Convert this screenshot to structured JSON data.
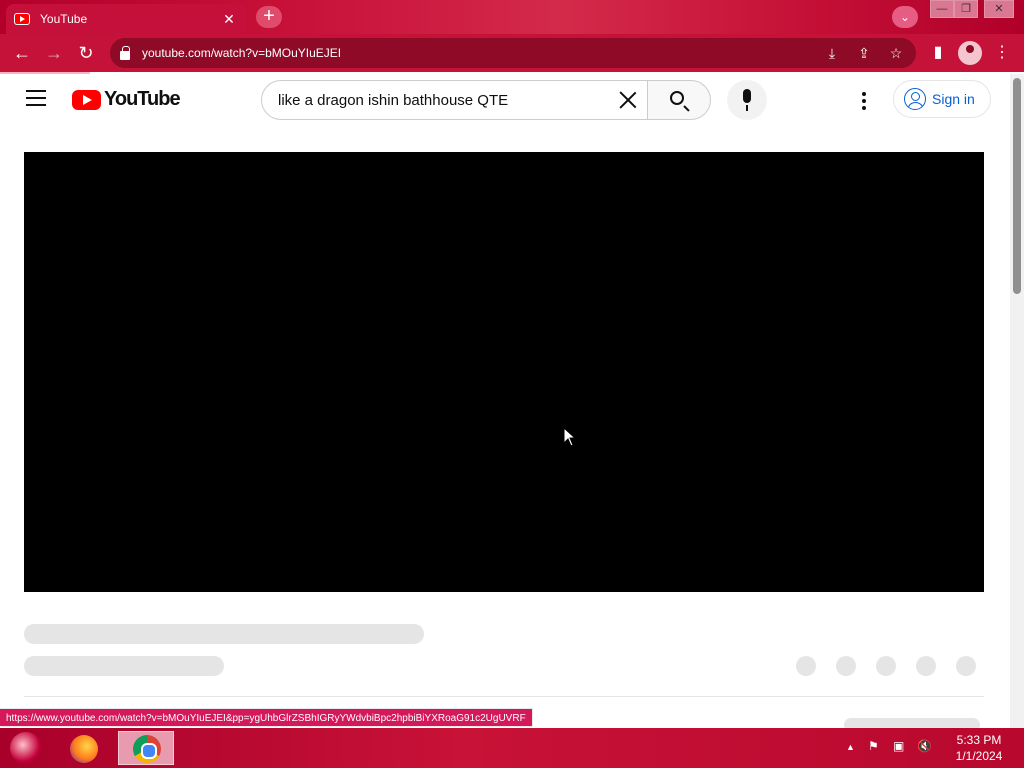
{
  "browser": {
    "tab_title": "YouTube",
    "tab_close": "✕",
    "new_tab": "+",
    "tab_search": "⌄",
    "url": "youtube.com/watch?v=bMOuYIuEJEI",
    "window_controls": [
      "—",
      "❐",
      "✕"
    ]
  },
  "youtube": {
    "logo_text": "YouTube",
    "search_query": "like a dragon ishin bathhouse QTE",
    "sign_in_label": "Sign in"
  },
  "status_url": "https://www.youtube.com/watch?v=bMOuYIuEJEI&pp=ygUhbGlrZSBhIGRyYWdvbiBpc2hpbiBiYXRoaG91c2UgUVRF",
  "taskbar": {
    "time": "5:33 PM",
    "date": "1/1/2024"
  },
  "colors": {
    "brand_red": "#ff0000",
    "link_blue": "#065fd4",
    "chrome_theme": "#c41238"
  }
}
